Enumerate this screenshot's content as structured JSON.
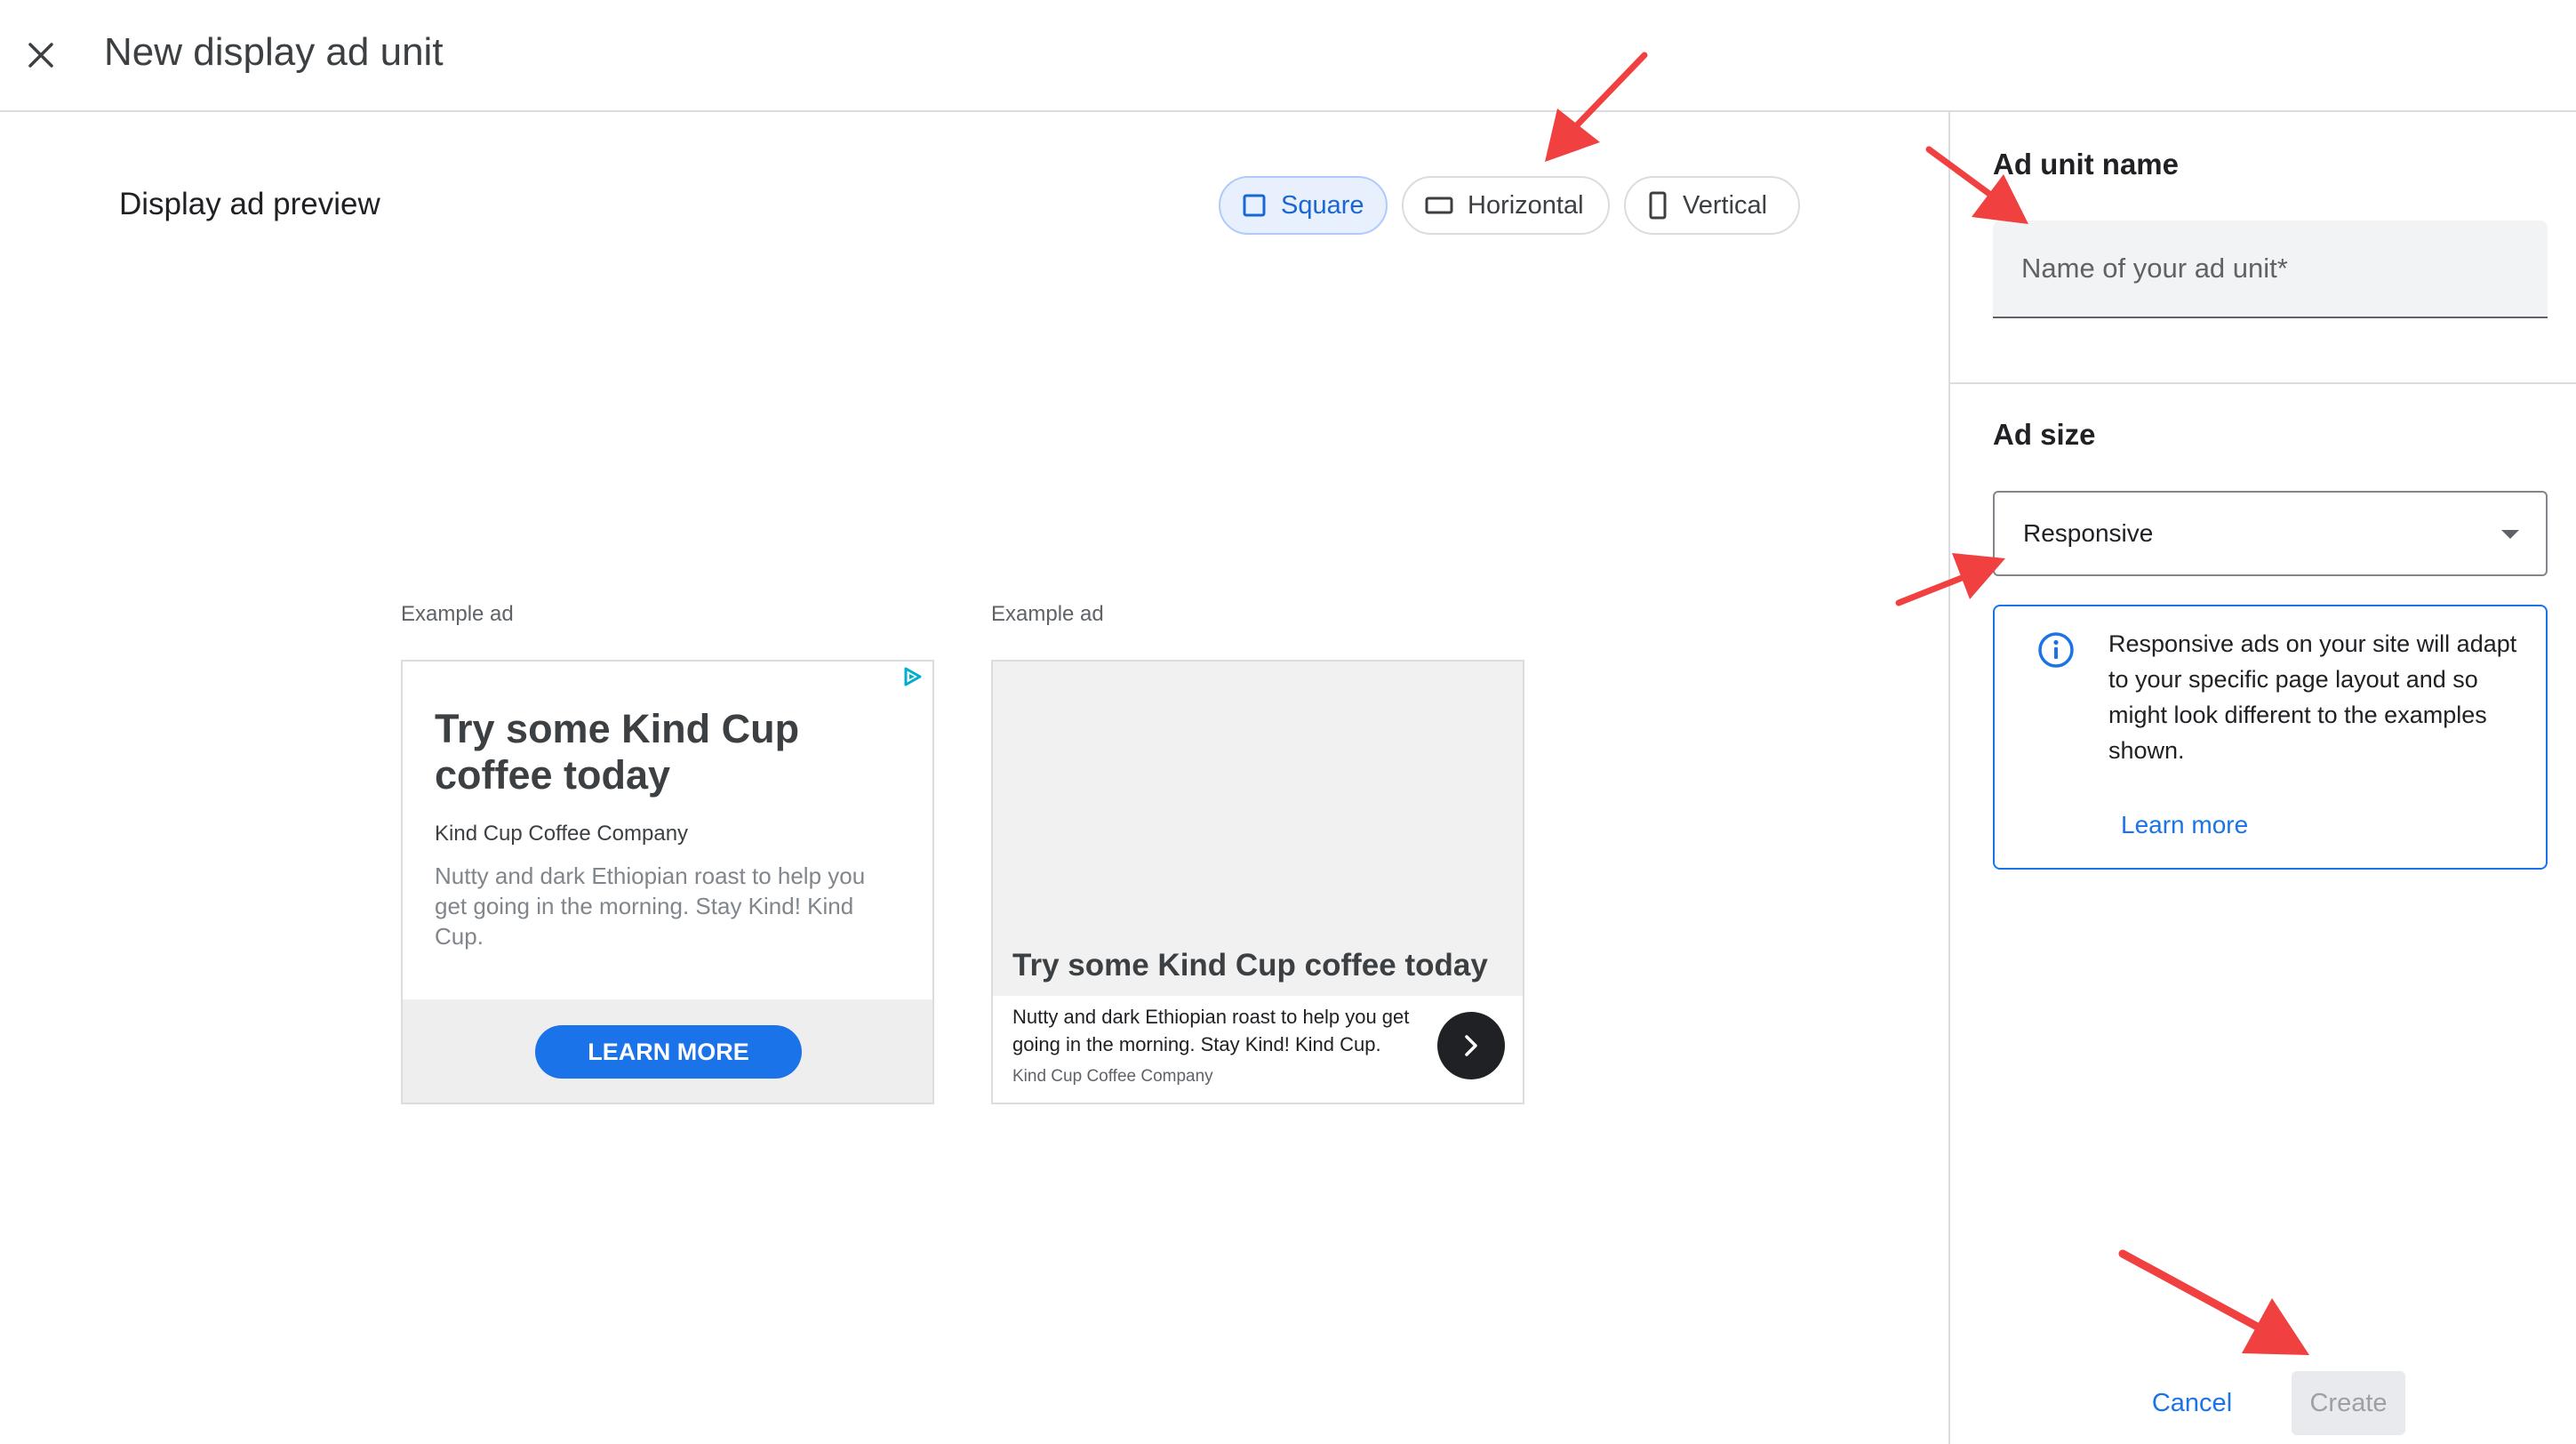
{
  "header": {
    "title": "New display ad unit",
    "close_icon": "close-icon"
  },
  "preview": {
    "title": "Display ad preview",
    "shapes": [
      {
        "label": "Square",
        "selected": true,
        "icon": "square-icon"
      },
      {
        "label": "Horizontal",
        "selected": false,
        "icon": "horizontal-rectangle-icon"
      },
      {
        "label": "Vertical",
        "selected": false,
        "icon": "vertical-rectangle-icon"
      }
    ],
    "examples": [
      {
        "label": "Example ad",
        "headline": "Try some Kind Cup coffee today",
        "company": "Kind Cup Coffee Company",
        "description": "Nutty and dark Ethiopian roast to help you get going in the morning. Stay Kind! Kind Cup.",
        "cta": "LEARN MORE",
        "adchoices_icon": "adchoices-icon"
      },
      {
        "label": "Example ad",
        "headline": "Try some Kind Cup coffee today",
        "description": "Nutty and dark Ethiopian roast to help you get going in the morning. Stay Kind! Kind Cup.",
        "company": "Kind Cup Coffee Company",
        "arrow_icon": "chevron-right-icon"
      }
    ]
  },
  "panel": {
    "name_section_title": "Ad unit name",
    "name_placeholder": "Name of your ad unit*",
    "name_value": "",
    "size_section_title": "Ad size",
    "size_value": "Responsive",
    "info_icon": "info-icon",
    "info_text": "Responsive ads on your site will adapt to your specific page layout and so might look different to the examples shown.",
    "learn_more": "Learn more",
    "cancel_label": "Cancel",
    "create_label": "Create"
  },
  "colors": {
    "accent": "#1a73e8",
    "selected_chip_bg": "#e8f0fe",
    "annotation_arrow": "#f04040",
    "disabled_bg": "#e8eaed"
  }
}
